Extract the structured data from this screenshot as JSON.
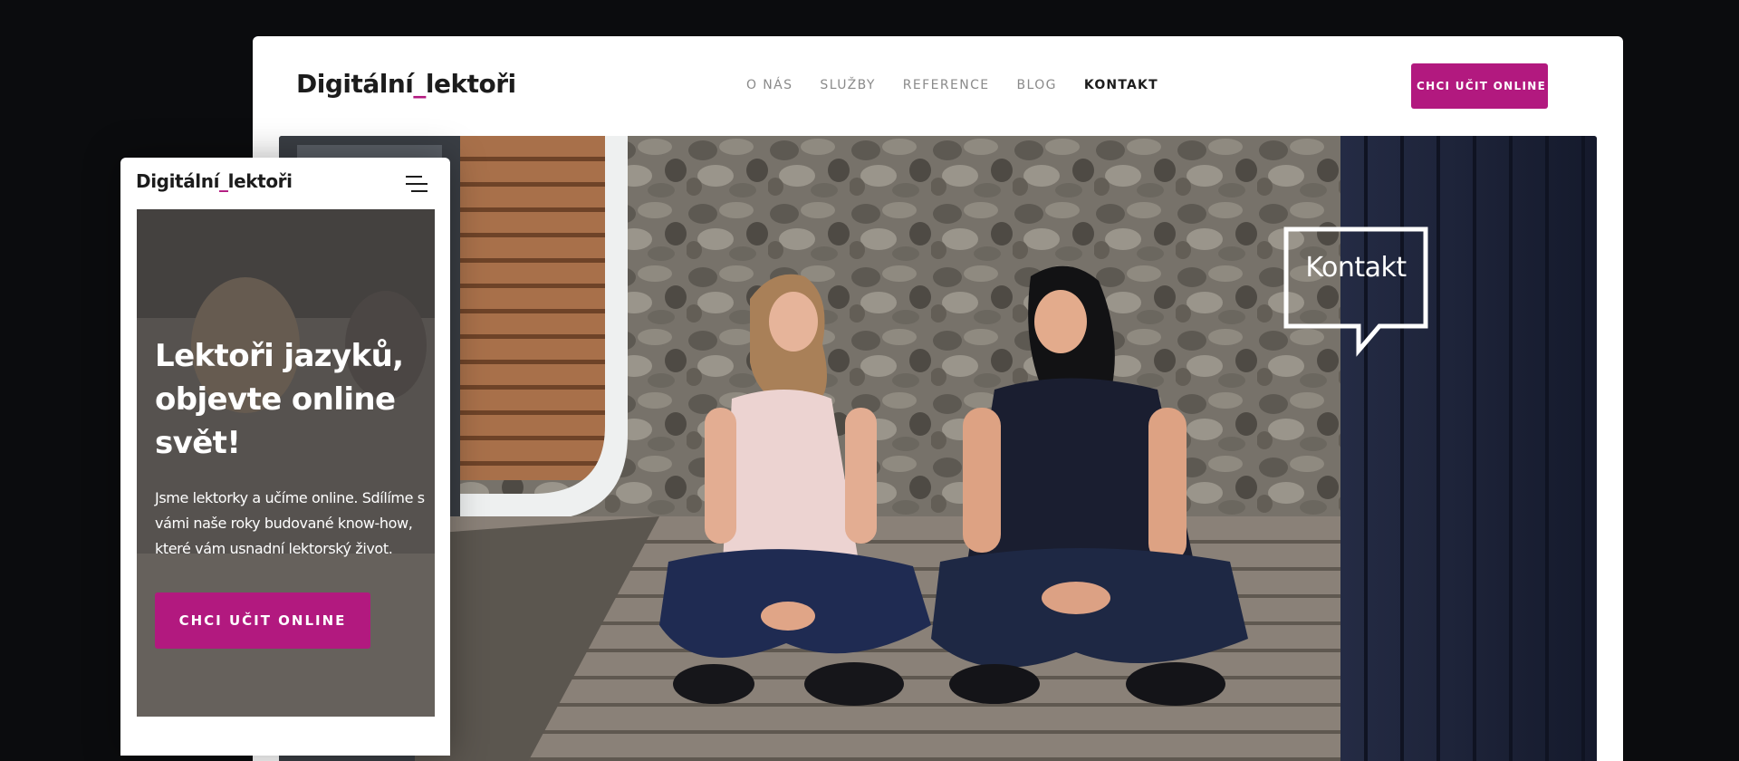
{
  "desktop": {
    "logo": {
      "main": "Digitální",
      "underscore": "_",
      "rest": "lektoři"
    },
    "nav": [
      {
        "label": "O NÁS"
      },
      {
        "label": "SLUŽBY"
      },
      {
        "label": "REFERENCE"
      },
      {
        "label": "BLOG"
      },
      {
        "label": "KONTAKT",
        "active": true
      }
    ],
    "cta_label": "CHCI UČIT ONLINE",
    "hero": {
      "bubble_text": "Kontakt"
    }
  },
  "mobile": {
    "logo": {
      "main": "Digitální",
      "underscore": "_",
      "rest": "lektoři"
    },
    "menu_icon": "hamburger-menu-icon",
    "hero": {
      "title_lines": [
        "Lektoři jazyků,",
        "objevte online",
        "svět!"
      ],
      "desc_lines": [
        "Jsme lektorky a učíme online. Sdílíme s",
        "vámi naše roky budované know-how,",
        "které vám usnadní lektorský život."
      ],
      "cta_label": "CHCI UČIT ONLINE"
    }
  },
  "colors": {
    "accent": "#b2197f",
    "page_background": "#0b0c0e",
    "text_dark": "#1c1c1c",
    "nav_inactive": "#8a8a8a"
  }
}
